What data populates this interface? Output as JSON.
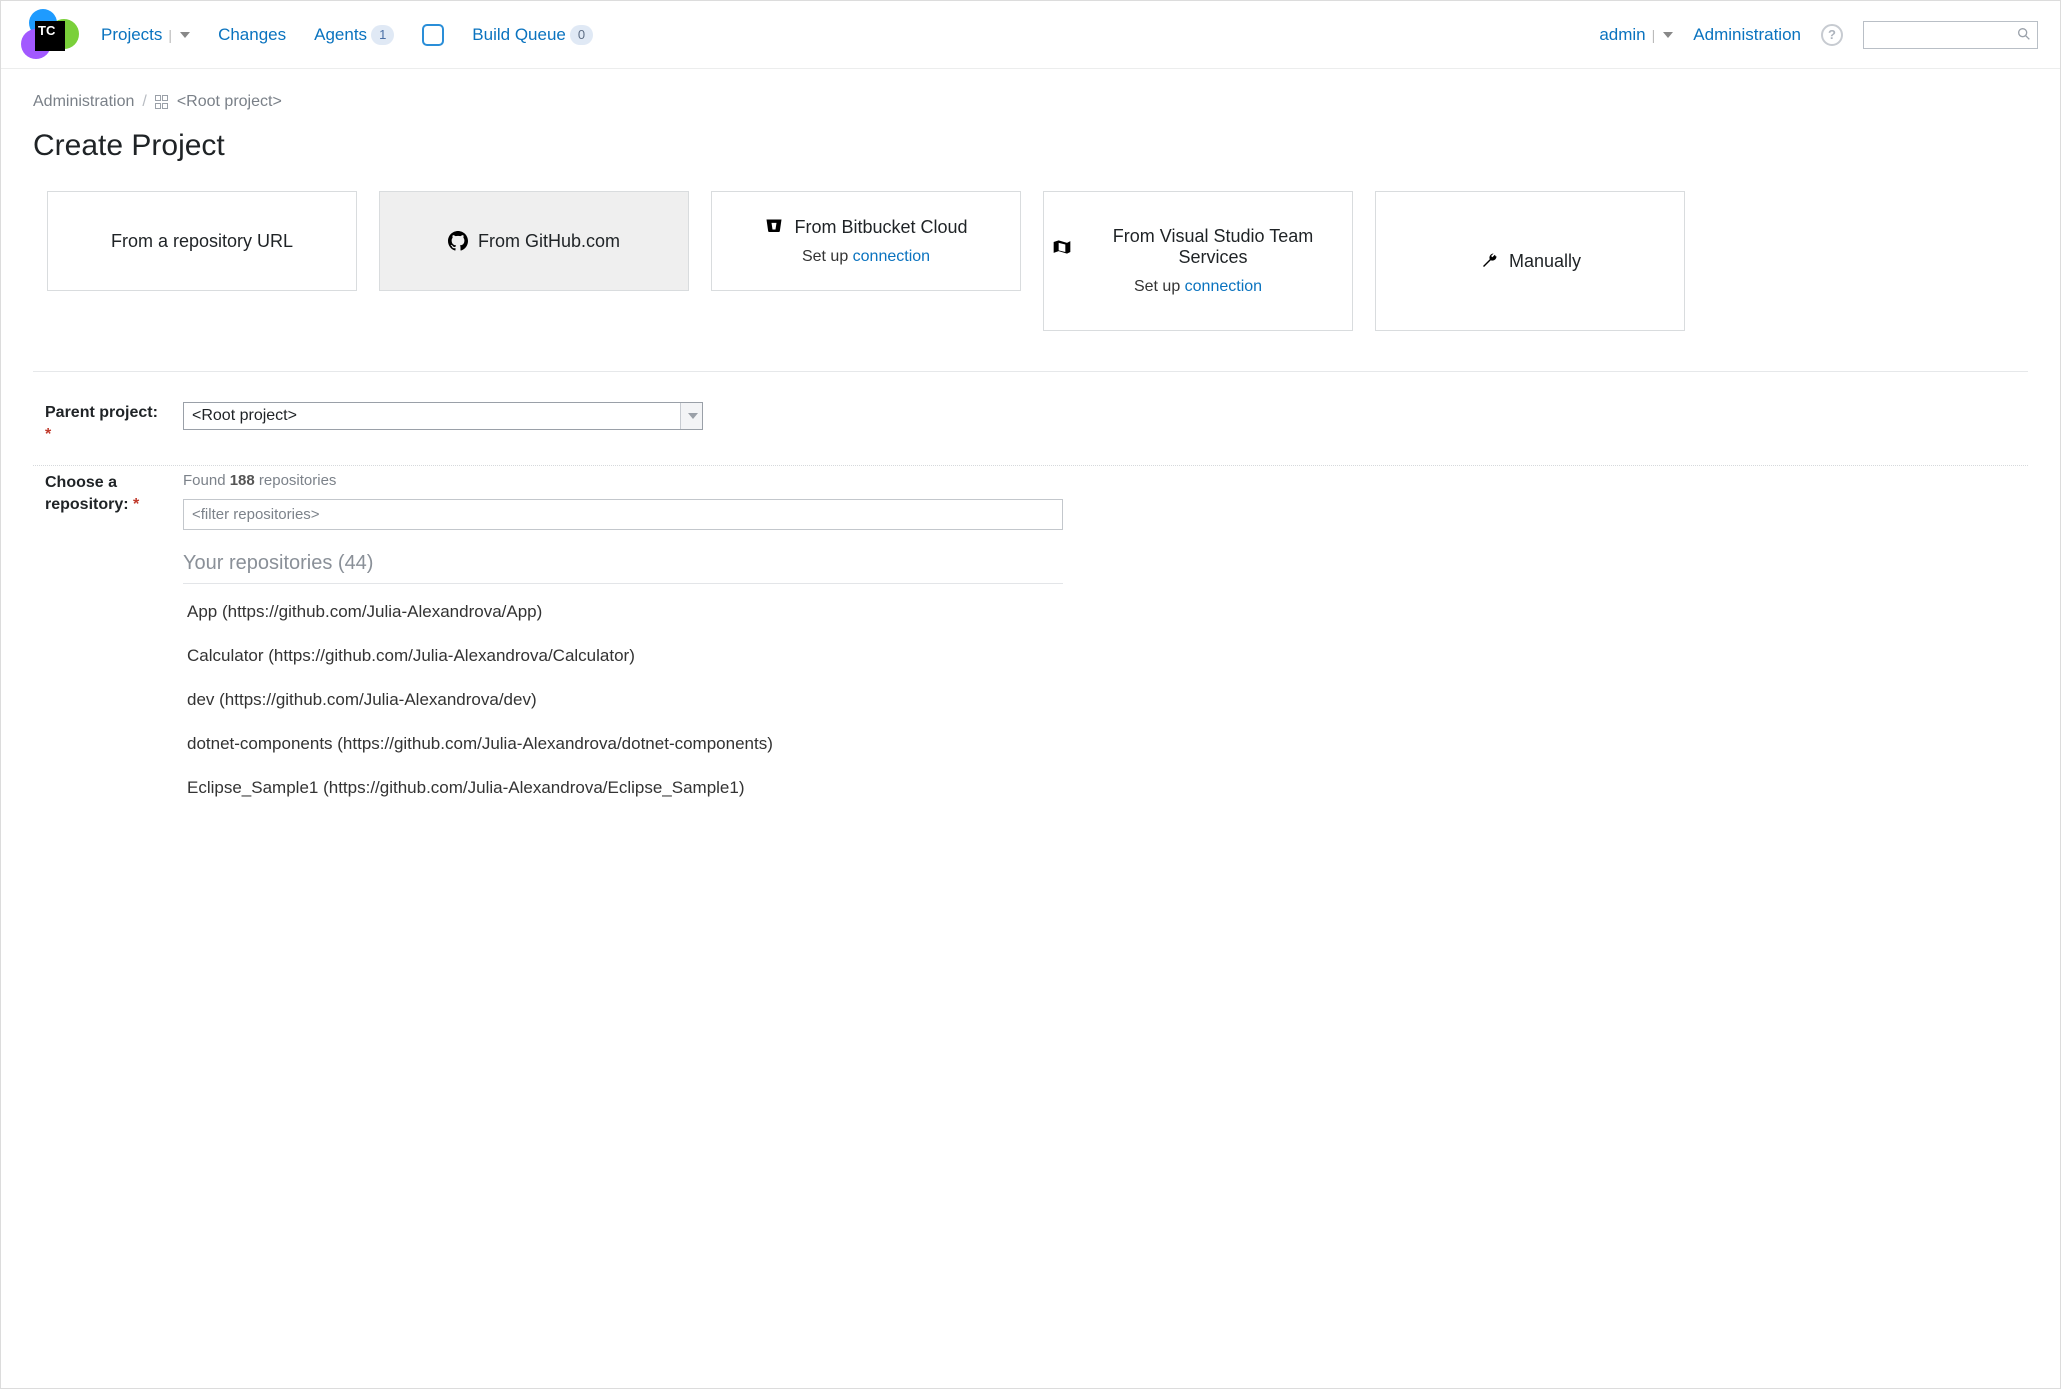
{
  "logo": {
    "text": "TC"
  },
  "nav": {
    "projects": "Projects",
    "changes": "Changes",
    "agents": "Agents",
    "agents_count": "1",
    "build_queue": "Build Queue",
    "build_queue_count": "0"
  },
  "nav_right": {
    "user": "admin",
    "administration": "Administration",
    "search_placeholder": "",
    "help_glyph": "?"
  },
  "breadcrumb": {
    "admin": "Administration",
    "root": "<Root project>"
  },
  "page_title": "Create Project",
  "tiles": {
    "repo_url": "From a repository URL",
    "github": "From GitHub.com",
    "bitbucket": "From Bitbucket Cloud",
    "bitbucket_setup_prefix": "Set up ",
    "bitbucket_setup_link": "connection",
    "vsts": "From Visual Studio Team Services",
    "vsts_setup_prefix": "Set up ",
    "vsts_setup_link": "connection",
    "manually": "Manually"
  },
  "form": {
    "parent_label": "Parent project:",
    "parent_value": "<Root project>",
    "choose_label": "Choose a repository:",
    "found_prefix": "Found ",
    "found_count": "188",
    "found_suffix": " repositories",
    "filter_placeholder": "<filter repositories>",
    "group_header": "Your repositories (44)",
    "repos": [
      "App (https://github.com/Julia-Alexandrova/App)",
      "Calculator (https://github.com/Julia-Alexandrova/Calculator)",
      "dev (https://github.com/Julia-Alexandrova/dev)",
      "dotnet-components (https://github.com/Julia-Alexandrova/dotnet-components)",
      "Eclipse_Sample1 (https://github.com/Julia-Alexandrova/Eclipse_Sample1)"
    ]
  }
}
